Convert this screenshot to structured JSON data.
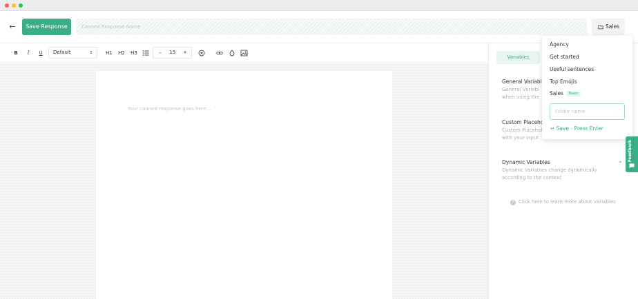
{
  "window": {
    "traffic_lights": [
      "close",
      "minimize",
      "zoom"
    ]
  },
  "header": {
    "back_icon": "arrow-left-icon",
    "save_label": "Save Response",
    "name_placeholder": "Canned Response Name",
    "name_value": "",
    "folder_label": "Sales",
    "accent": "#3aaf85"
  },
  "toolbar": {
    "bold": "B",
    "italic": "I",
    "underline": "U",
    "font_family": "Default",
    "h1": "H1",
    "h2": "H2",
    "h3": "H3",
    "font_size_decrease": "–",
    "font_size": "15",
    "font_size_increase": "+"
  },
  "editor": {
    "placeholder": "Your canned response goes here..."
  },
  "sidebar": {
    "tab": "Variables",
    "sections": [
      {
        "title": "General Variable",
        "desc_line1": "General Variabl",
        "desc_line2": "when using the"
      },
      {
        "title": "Custom Placeho",
        "desc_line1": "Custom Placehol",
        "desc_line2": "with your input"
      },
      {
        "title": "Dynamic Variables",
        "desc_line1": "Dynamic Variables change dynamically",
        "desc_line2": "according to the context"
      }
    ],
    "learn_more": "Click here to learn more about variables"
  },
  "folder_dropdown": {
    "items": [
      "Agency",
      "Get started",
      "Useful sentences",
      "Top Emojis",
      "Sales"
    ],
    "team_badge": "Team",
    "input_placeholder": "Folder name",
    "save_hint": "Save - Press Enter"
  },
  "feedback": {
    "label": "Feedback"
  }
}
